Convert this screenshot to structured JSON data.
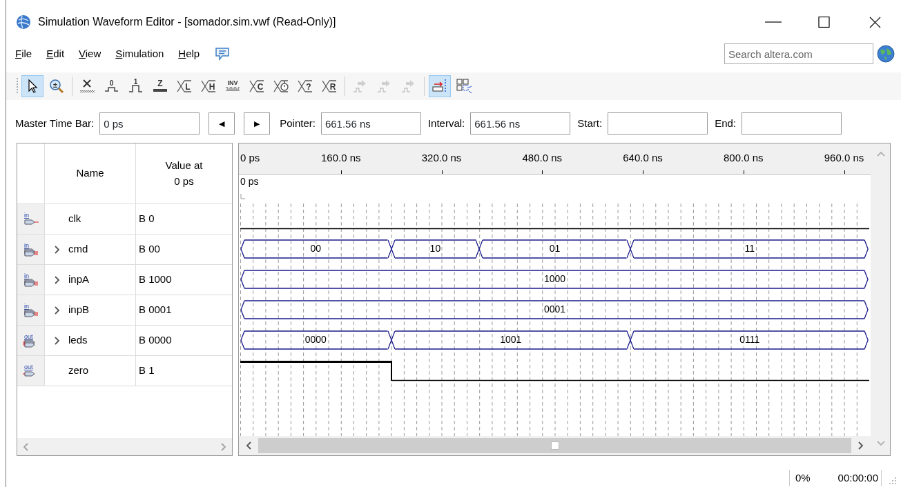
{
  "window": {
    "title": "Simulation Waveform Editor - [somador.sim.vwf (Read-Only)]"
  },
  "menu": [
    {
      "label": "File"
    },
    {
      "label": "Edit"
    },
    {
      "label": "View"
    },
    {
      "label": "Simulation"
    },
    {
      "label": "Help"
    }
  ],
  "search": {
    "placeholder": "Search altera.com"
  },
  "toolbar": [
    {
      "kind": "pointer",
      "selected": true
    },
    {
      "kind": "zoom",
      "glyph": "±",
      "selected": false
    },
    {
      "kind": "separator"
    },
    {
      "kind": "unknown",
      "selected": false
    },
    {
      "kind": "step-low",
      "glyph": "0",
      "selected": false
    },
    {
      "kind": "step-high",
      "glyph": "1",
      "selected": false
    },
    {
      "kind": "bar",
      "glyph": "Z",
      "selected": false
    },
    {
      "kind": "bus",
      "glyph": "L",
      "selected": false
    },
    {
      "kind": "bus",
      "glyph": "H",
      "selected": false
    },
    {
      "kind": "invert",
      "glyph": "INV",
      "selected": false
    },
    {
      "kind": "bus",
      "glyph": "C",
      "selected": false
    },
    {
      "kind": "clock",
      "selected": false
    },
    {
      "kind": "bus",
      "glyph": "?",
      "selected": false
    },
    {
      "kind": "bus",
      "glyph": "R",
      "selected": false
    },
    {
      "kind": "separator"
    },
    {
      "kind": "run",
      "disabled": true,
      "selected": false
    },
    {
      "kind": "run",
      "disabled": true,
      "selected": false
    },
    {
      "kind": "run",
      "disabled": true,
      "selected": false
    },
    {
      "kind": "separator"
    },
    {
      "kind": "snap",
      "selected": true
    },
    {
      "kind": "grid",
      "selected": false
    }
  ],
  "time_bar": {
    "master": {
      "label": "Master Time Bar:",
      "value": "0 ps"
    },
    "prev": "◀",
    "next": "▶",
    "fields": [
      {
        "label": "Pointer:",
        "value": "661.56 ns"
      },
      {
        "label": "Interval:",
        "value": "661.56 ns"
      },
      {
        "label": "Start:"
      },
      {
        "label": "End:"
      }
    ]
  },
  "signal_table": {
    "columns": [
      "Name",
      "Value at\n0 ps"
    ]
  },
  "signals": [
    {
      "name": "clk",
      "value": "B 0",
      "pin": "in",
      "kind": "bit",
      "segments": [
        {
          "high": false
        }
      ]
    },
    {
      "name": "cmd",
      "value": "B 00",
      "pin": "in",
      "kind": "bus",
      "expanded": false,
      "segments": [
        {
          "value": "00"
        },
        {
          "value": "10"
        },
        {
          "value": "01"
        },
        {
          "value": "11"
        }
      ],
      "transitions": [
        {
          "level": 0.24
        },
        {
          "level": 0.38
        },
        {
          "level": 0.62
        }
      ]
    },
    {
      "name": "inpA",
      "value": "B 1000",
      "pin": "in",
      "kind": "bus",
      "expanded": false,
      "segments": [
        {
          "value": "1000"
        }
      ]
    },
    {
      "name": "inpB",
      "value": "B 0001",
      "pin": "in",
      "kind": "bus",
      "expanded": false,
      "segments": [
        {
          "value": "0001"
        }
      ]
    },
    {
      "name": "leds",
      "value": "B 0000",
      "pin": "out",
      "kind": "bus",
      "expanded": false,
      "segments": [
        {
          "value": "0000"
        },
        {
          "value": "1001"
        },
        {
          "value": "0111"
        }
      ],
      "transitions": [
        {
          "level": 0.24
        },
        {
          "level": 0.62
        }
      ]
    },
    {
      "name": "zero",
      "value": "B 1",
      "pin": "out",
      "kind": "bit",
      "segments": [
        {
          "high": true
        },
        {
          "high": false
        }
      ],
      "transitions": [
        {
          "level": 0.24
        }
      ]
    }
  ],
  "waveform": {
    "ticks": [
      "0 ps",
      "160.0 ns",
      "320.0 ns",
      "480.0 ns",
      "640.0 ns",
      "800.0 ns",
      "960.0 ns"
    ],
    "marker": "0 ps"
  },
  "status_bar": {
    "progress": "0%",
    "elapsed": "00:00:00"
  }
}
